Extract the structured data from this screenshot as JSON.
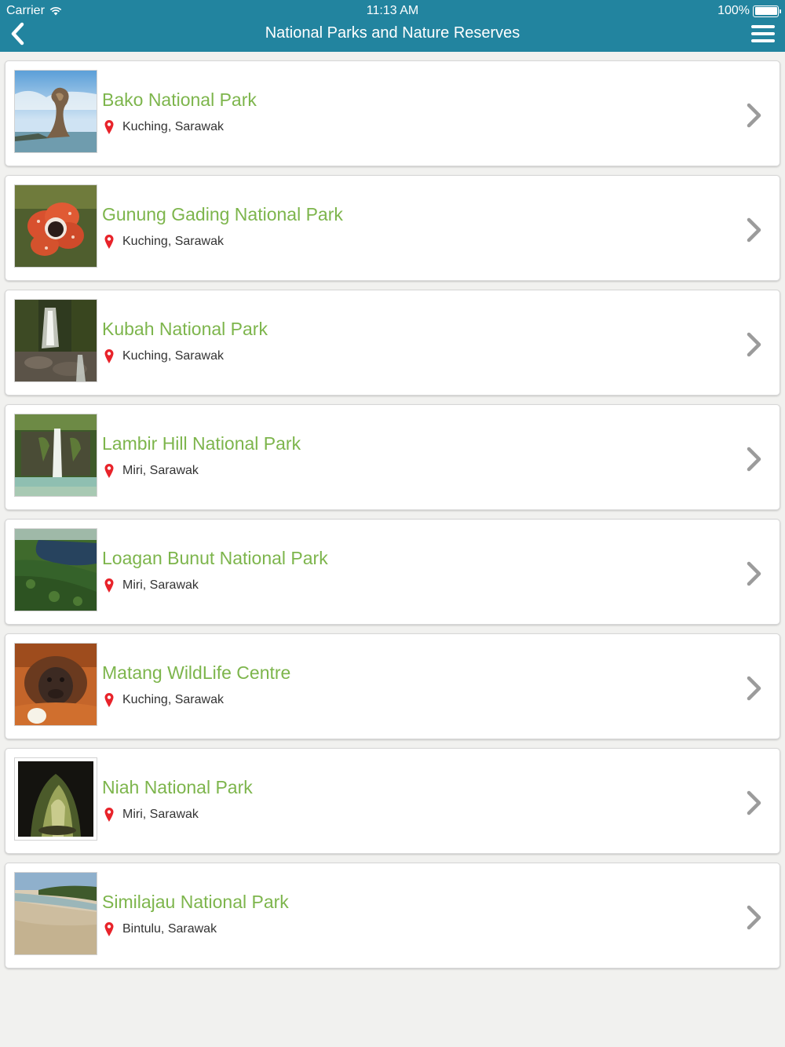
{
  "status_bar": {
    "carrier": "Carrier",
    "time": "11:13 AM",
    "battery": "100%"
  },
  "nav": {
    "title": "National Parks and Nature Reserves",
    "back_icon": "chevron-left-icon",
    "menu_icon": "hamburger-menu-icon"
  },
  "colors": {
    "nav_bg": "#22849f",
    "title_green": "#7db54c",
    "pin_red": "#e8232a"
  },
  "parks": [
    {
      "name": "Bako National Park",
      "location": "Kuching, Sarawak",
      "image": "sea-stack-rock-photo"
    },
    {
      "name": "Gunung Gading National Park",
      "location": "Kuching, Sarawak",
      "image": "rafflesia-flower-photo"
    },
    {
      "name": "Kubah National Park",
      "location": "Kuching, Sarawak",
      "image": "forest-waterfall-photo"
    },
    {
      "name": "Lambir Hill National Park",
      "location": "Miri, Sarawak",
      "image": "waterfall-pool-photo"
    },
    {
      "name": "Loagan Bunut National Park",
      "location": "Miri, Sarawak",
      "image": "aerial-lake-forest-photo"
    },
    {
      "name": "Matang WildLife Centre",
      "location": "Kuching, Sarawak",
      "image": "orangutan-photo"
    },
    {
      "name": "Niah National Park",
      "location": "Miri, Sarawak",
      "image": "cave-entrance-photo"
    },
    {
      "name": "Similajau National Park",
      "location": "Bintulu, Sarawak",
      "image": "sandy-beach-photo"
    }
  ]
}
